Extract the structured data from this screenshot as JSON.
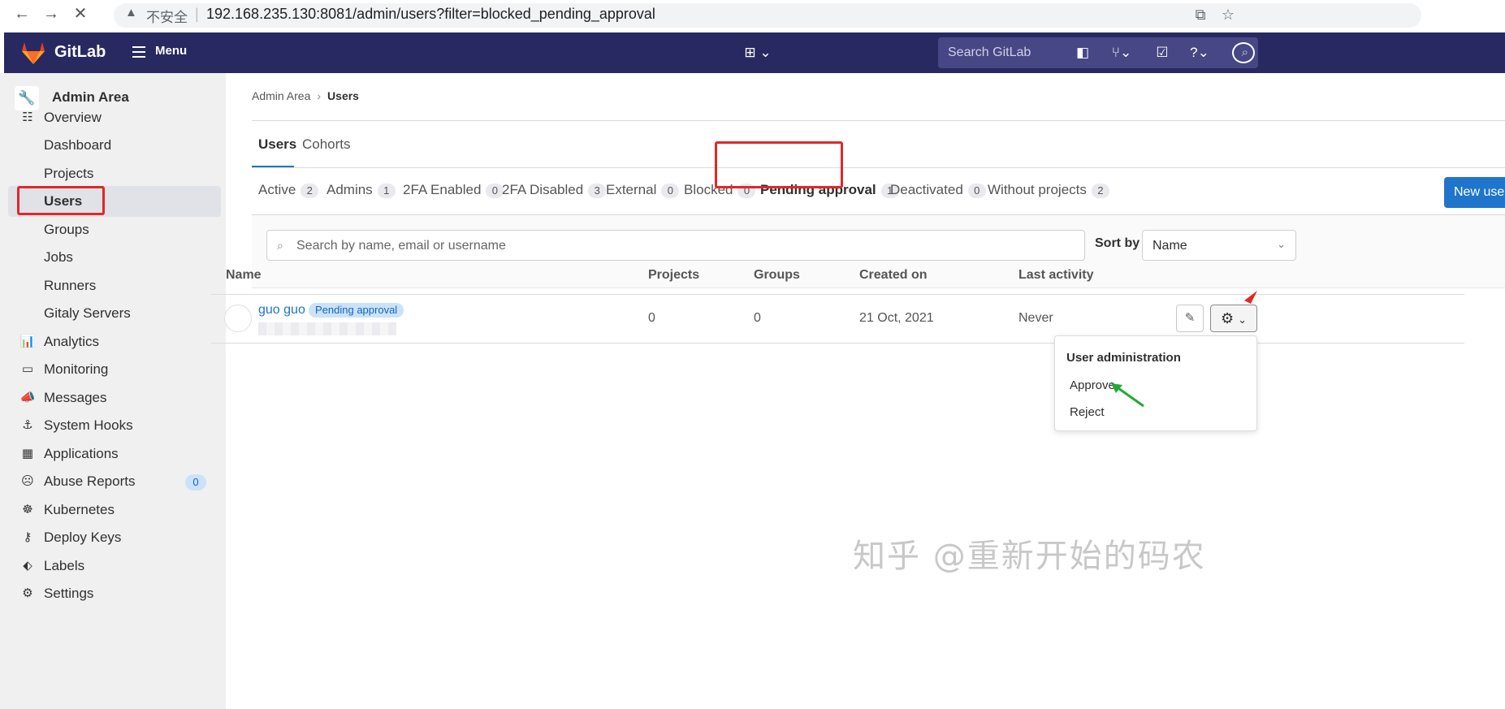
{
  "browser": {
    "back": "←",
    "forward": "→",
    "reload": "✕",
    "insecure_label": "不安全",
    "url": "192.168.235.130:8081/admin/users?filter=blocked_pending_approval",
    "translate_icon": "translate-icon",
    "bookmark_icon": "star-icon"
  },
  "header": {
    "brand": "GitLab",
    "menu_label": "Menu",
    "search_placeholder": "Search GitLab"
  },
  "sidebar": {
    "title": "Admin Area",
    "items": [
      {
        "label": "Overview",
        "icon": "overview-icon"
      },
      {
        "label": "Dashboard"
      },
      {
        "label": "Projects"
      },
      {
        "label": "Users"
      },
      {
        "label": "Groups"
      },
      {
        "label": "Jobs"
      },
      {
        "label": "Runners"
      },
      {
        "label": "Gitaly Servers"
      },
      {
        "label": "Analytics",
        "icon": "analytics-icon"
      },
      {
        "label": "Monitoring",
        "icon": "monitoring-icon"
      },
      {
        "label": "Messages",
        "icon": "messages-icon"
      },
      {
        "label": "System Hooks",
        "icon": "hook-icon"
      },
      {
        "label": "Applications",
        "icon": "applications-icon"
      },
      {
        "label": "Abuse Reports",
        "icon": "abuse-icon",
        "badge": "0"
      },
      {
        "label": "Kubernetes",
        "icon": "kubernetes-icon"
      },
      {
        "label": "Deploy Keys",
        "icon": "key-icon"
      },
      {
        "label": "Labels",
        "icon": "label-icon"
      },
      {
        "label": "Settings",
        "icon": "settings-icon"
      }
    ]
  },
  "breadcrumb": {
    "parent": "Admin Area",
    "current": "Users"
  },
  "top_tabs": [
    "Users",
    "Cohorts"
  ],
  "filter_tabs": [
    {
      "label": "Active",
      "count": "2"
    },
    {
      "label": "Admins",
      "count": "1"
    },
    {
      "label": "2FA Enabled",
      "count": "0"
    },
    {
      "label": "2FA Disabled",
      "count": "3"
    },
    {
      "label": "External",
      "count": "0"
    },
    {
      "label": "Blocked",
      "count": "0"
    },
    {
      "label": "Pending approval",
      "count": "1"
    },
    {
      "label": "Deactivated",
      "count": "0"
    },
    {
      "label": "Without projects",
      "count": "2"
    }
  ],
  "new_user_label": "New user",
  "search": {
    "placeholder": "Search by name, email or username",
    "sort_label": "Sort by",
    "sort_value": "Name"
  },
  "table": {
    "headers": [
      "Name",
      "Projects",
      "Groups",
      "Created on",
      "Last activity"
    ],
    "rows": [
      {
        "name": "guo guo",
        "badge": "Pending approval",
        "projects": "0",
        "groups": "0",
        "created_on": "21 Oct, 2021",
        "last_activity": "Never"
      }
    ]
  },
  "dropdown": {
    "header": "User administration",
    "items": [
      "Approve",
      "Reject"
    ]
  },
  "watermark": "知乎 @重新开始的码农",
  "colors": {
    "header_bg": "#292961",
    "accent": "#1f75cb",
    "annotation_red": "#e02828",
    "annotation_green": "#22a83a"
  }
}
